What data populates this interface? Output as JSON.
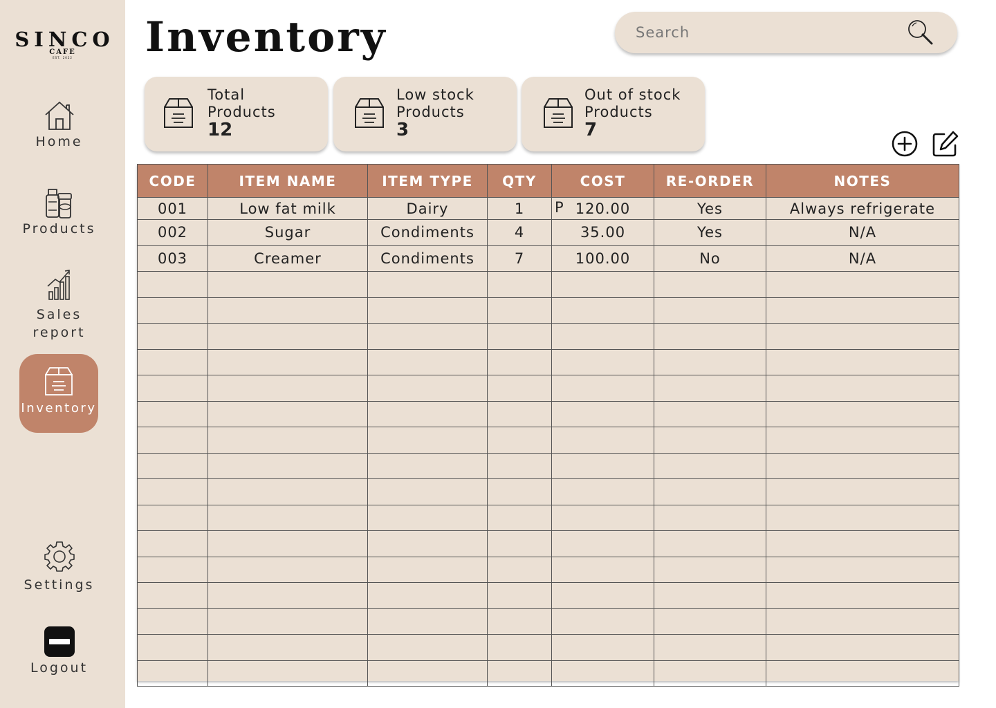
{
  "brand": {
    "name": "SINCO",
    "sub": "CAFE",
    "est": "EST. 2022"
  },
  "sidebar": {
    "items": [
      {
        "label": "Home",
        "icon": "home-icon"
      },
      {
        "label": "Products",
        "icon": "products-icon"
      },
      {
        "label": "Sales report",
        "line1": "Sales",
        "line2": "report",
        "icon": "bar-chart-icon"
      },
      {
        "label": "Inventory",
        "icon": "inventory-box-icon",
        "active": true
      },
      {
        "label": "Settings",
        "icon": "gear-icon"
      },
      {
        "label": "Logout",
        "icon": "logout-icon"
      }
    ]
  },
  "header": {
    "title": "Inventory"
  },
  "search": {
    "placeholder": "Search",
    "icon": "search-icon"
  },
  "stats": [
    {
      "line1": "Total",
      "line2": "Products",
      "value": "12",
      "icon": "box-icon"
    },
    {
      "line1": "Low stock",
      "line2": "Products",
      "value": "3",
      "icon": "box-icon"
    },
    {
      "line1": "Out of stock",
      "line2": "Products",
      "value": "7",
      "icon": "box-icon"
    }
  ],
  "actions": {
    "add_icon": "plus-circle-icon",
    "edit_icon": "edit-icon"
  },
  "table": {
    "columns": [
      "CODE",
      "ITEM NAME",
      "ITEM TYPE",
      "QTY",
      "COST",
      "RE-ORDER",
      "NOTES"
    ],
    "currency": "P",
    "rows": [
      {
        "code": "001",
        "name": "Low fat milk",
        "type": "Dairy",
        "qty": "1",
        "currency": "P",
        "cost": "120.00",
        "reorder": "Yes",
        "notes": "Always refrigerate"
      },
      {
        "code": "002",
        "name": "Sugar",
        "type": "Condiments",
        "qty": "4",
        "currency": "",
        "cost": "35.00",
        "reorder": "Yes",
        "notes": "N/A"
      },
      {
        "code": "003",
        "name": "Creamer",
        "type": "Condiments",
        "qty": "7",
        "currency": "",
        "cost": "100.00",
        "reorder": "No",
        "notes": "N/A"
      }
    ],
    "empty_rows": 16
  },
  "colors": {
    "sidebar_bg": "#ebe0d4",
    "accent": "#c0846a",
    "card_bg": "#ebe0d4",
    "text": "#222222"
  }
}
